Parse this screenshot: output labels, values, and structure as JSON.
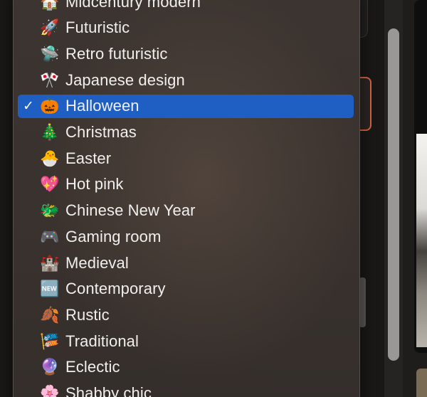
{
  "menu": {
    "items": [
      {
        "label": "Midcentury modern",
        "emoji": "🏠",
        "icon": "midcentury-modern-icon",
        "selected": false
      },
      {
        "label": "Futuristic",
        "emoji": "🚀",
        "icon": "rocket-icon",
        "selected": false
      },
      {
        "label": "Retro futuristic",
        "emoji": "🛸",
        "icon": "flying-saucer-icon",
        "selected": false
      },
      {
        "label": "Japanese design",
        "emoji": "🎌",
        "icon": "crossed-flags-icon",
        "selected": false
      },
      {
        "label": "Halloween",
        "emoji": "🎃",
        "icon": "jack-o-lantern-icon",
        "selected": true
      },
      {
        "label": "Christmas",
        "emoji": "🎄",
        "icon": "christmas-tree-icon",
        "selected": false
      },
      {
        "label": "Easter",
        "emoji": "🐣",
        "icon": "hatching-chick-icon",
        "selected": false
      },
      {
        "label": "Hot pink",
        "emoji": "💖",
        "icon": "sparkling-heart-icon",
        "selected": false
      },
      {
        "label": "Chinese New Year",
        "emoji": "🐲",
        "icon": "dragon-face-icon",
        "selected": false
      },
      {
        "label": "Gaming room",
        "emoji": "🎮",
        "icon": "game-controller-icon",
        "selected": false
      },
      {
        "label": "Medieval",
        "emoji": "🏰",
        "icon": "castle-icon",
        "selected": false
      },
      {
        "label": "Contemporary",
        "emoji": "🆕",
        "icon": "new-button-icon",
        "selected": false
      },
      {
        "label": "Rustic",
        "emoji": "🍂",
        "icon": "fallen-leaf-icon",
        "selected": false
      },
      {
        "label": "Traditional",
        "emoji": "🎏",
        "icon": "carp-streamer-icon",
        "selected": false
      },
      {
        "label": "Eclectic",
        "emoji": "🔮",
        "icon": "crystal-ball-icon",
        "selected": false
      },
      {
        "label": "Shabby chic",
        "emoji": "🌸",
        "icon": "cherry-blossom-icon",
        "selected": false
      }
    ],
    "check_mark": "✓",
    "selected_color": "#1f5fc4"
  }
}
